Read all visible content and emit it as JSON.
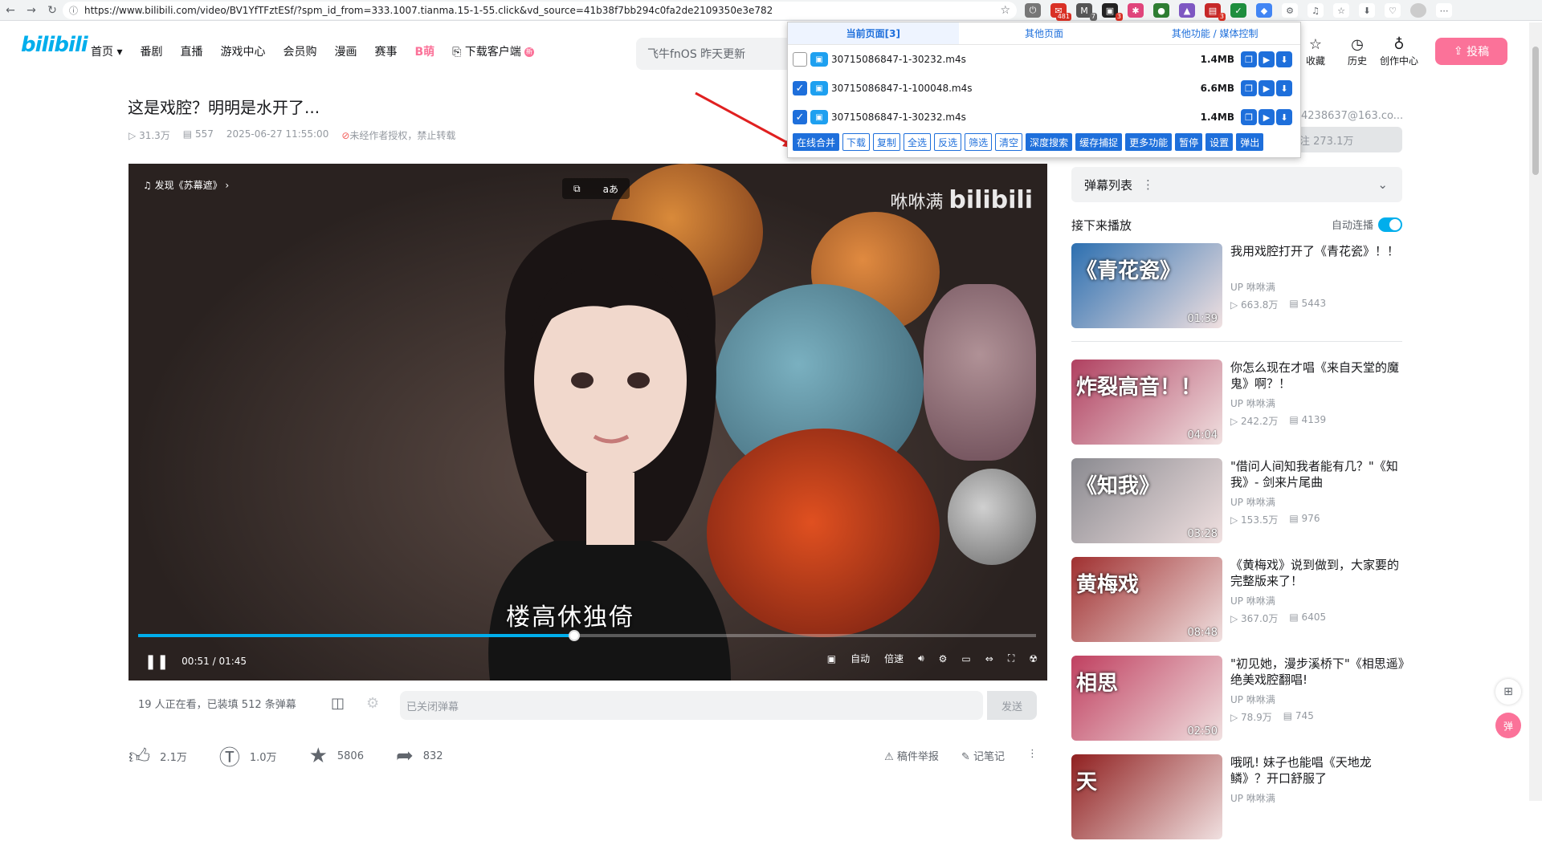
{
  "browser": {
    "url": "https://www.bilibili.com/video/BV1YfTFztESf/?spm_id_from=333.1007.tianma.15-1-55.click&vd_source=41b38f7bb294c0fa2de2109350e3e782",
    "ext_badges": [
      "481",
      "7",
      "3",
      "3"
    ]
  },
  "header": {
    "logo": "bilibili",
    "nav": [
      "首页",
      "番剧",
      "直播",
      "游戏中心",
      "会员购",
      "漫画",
      "赛事",
      "B萌",
      "下载客户端"
    ],
    "download_badge": "新",
    "search_placeholder": "飞牛fnOS 昨天更新",
    "right_nav": [
      "收藏",
      "历史",
      "创作中心"
    ],
    "upload": "投稿"
  },
  "video": {
    "title": "这是戏腔？明明是水开了...",
    "views": "31.3万",
    "danmaku_count": "557",
    "datetime": "2025-06-27 11:55:00",
    "copyright": "未经作者授权，禁止转载"
  },
  "player": {
    "music_tag": "发现《苏幕遮》",
    "watermark": "咻咻满",
    "watermark_logo": "bilibili",
    "subtitle": "楼高休独倚",
    "current_time": "00:51",
    "total_time": "01:45",
    "progress": 0.486,
    "quality": "自动",
    "speed": "倍速"
  },
  "danmaku": {
    "watching": "19 人正在看，已装填 512 条弹幕",
    "input_placeholder": "已关闭弹幕",
    "send": "发送"
  },
  "actions": {
    "like": "2.1万",
    "coin": "1.0万",
    "fav": "5806",
    "share": "832",
    "report": "稿件举报",
    "note": "记笔记"
  },
  "sidebar": {
    "uploader_text": "4238637@163.co...",
    "follow": "注 273.1万",
    "danmaku_list": "弹幕列表",
    "next_up": "接下来播放",
    "autoplay": "自动连播",
    "recs": [
      {
        "title": "我用戏腔打开了《青花瓷》！！",
        "author": "咻咻满",
        "views": "663.8万",
        "dm": "5443",
        "dur": "01:39",
        "thumb_text": "《青花瓷》",
        "color": "#2c6fb0"
      },
      {
        "title": "你怎么现在才唱《来自天堂的魔鬼》啊？！",
        "author": "咻咻满",
        "views": "242.2万",
        "dm": "4139",
        "dur": "04:04",
        "thumb_text": "炸裂高音！！",
        "color": "#b04060"
      },
      {
        "title": "\"借问人间知我者能有几？\"《知我》- 剑来片尾曲",
        "author": "咻咻满",
        "views": "153.5万",
        "dm": "976",
        "dur": "03:28",
        "thumb_text": "《知我》",
        "color": "#8a8a90"
      },
      {
        "title": "《黄梅戏》说到做到，大家要的完整版来了！",
        "author": "咻咻满",
        "views": "367.0万",
        "dm": "6405",
        "dur": "08:48",
        "thumb_text": "黄梅戏",
        "color": "#a03030"
      },
      {
        "title": "\"初见她，漫步溪桥下\"《相思遥》绝美戏腔翻唱!",
        "author": "咻咻满",
        "views": "78.9万",
        "dm": "745",
        "dur": "02:50",
        "thumb_text": "相思",
        "color": "#c04060"
      },
      {
        "title": "哦吼! 妹子也能唱《天地龙鳞》？开口舒服了",
        "author": "咻咻满",
        "views": "",
        "dm": "",
        "dur": "",
        "thumb_text": "天",
        "color": "#902020"
      }
    ]
  },
  "popup": {
    "tabs": [
      "当前页面[3]",
      "其他页面",
      "其他功能 / 媒体控制"
    ],
    "rows": [
      {
        "name": "30715086847-1-30232.m4s",
        "size": "1.4MB",
        "checked": false
      },
      {
        "name": "30715086847-1-100048.m4s",
        "size": "6.6MB",
        "checked": true
      },
      {
        "name": "30715086847-1-30232.m4s",
        "size": "1.4MB",
        "checked": true
      }
    ],
    "buttons": [
      "在线合并",
      "下载",
      "复制",
      "全选",
      "反选",
      "筛选",
      "清空",
      "深度搜索",
      "缓存捕捉",
      "更多功能",
      "暂停",
      "设置",
      "弹出"
    ]
  },
  "side_buttons": [
    "弹"
  ]
}
